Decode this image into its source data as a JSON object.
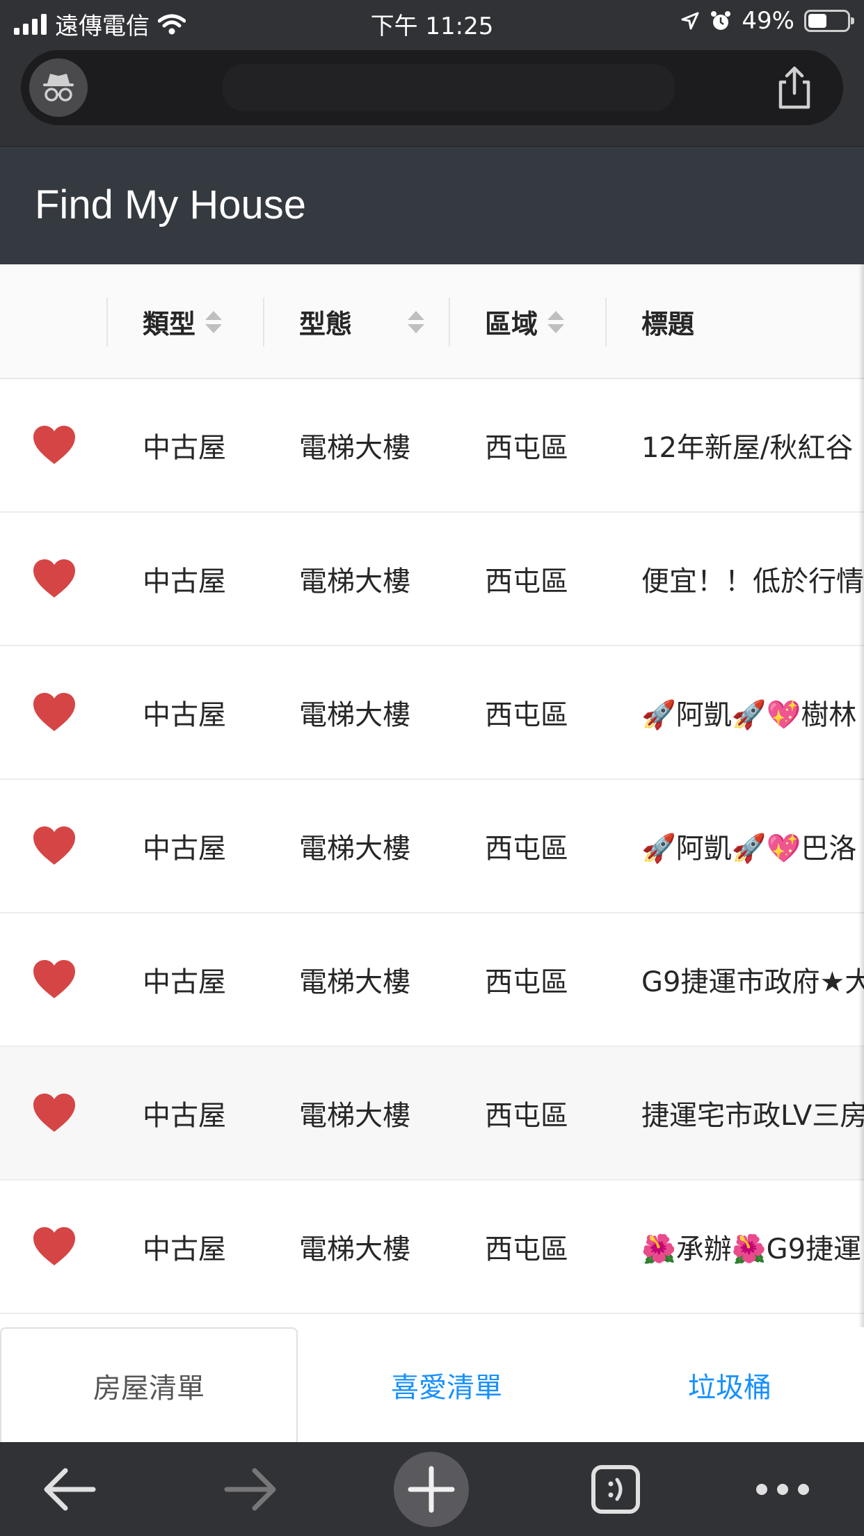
{
  "status_bar": {
    "carrier": "遠傳電信",
    "time": "下午 11:25",
    "battery_percent": "49%",
    "battery_level": 0.49
  },
  "browser": {
    "mode": "incognito",
    "icons": [
      "incognito-icon",
      "share-icon",
      "back-icon",
      "forward-icon",
      "new-tab-icon",
      "tabs-icon",
      "more-icon"
    ]
  },
  "app": {
    "title": "Find My House"
  },
  "table": {
    "columns": [
      {
        "label": "",
        "sortable": false
      },
      {
        "label": "類型",
        "sortable": true
      },
      {
        "label": "型態",
        "sortable": true
      },
      {
        "label": "區域",
        "sortable": true
      },
      {
        "label": "標題",
        "sortable": false
      }
    ],
    "rows": [
      {
        "favorite": true,
        "type": "中古屋",
        "form": "電梯大樓",
        "district": "西屯區",
        "title": "12年新屋/秋紅谷"
      },
      {
        "favorite": true,
        "type": "中古屋",
        "form": "電梯大樓",
        "district": "西屯區",
        "title": "便宜！！低於行情"
      },
      {
        "favorite": true,
        "type": "中古屋",
        "form": "電梯大樓",
        "district": "西屯區",
        "title": "🚀阿凱🚀💖樹林"
      },
      {
        "favorite": true,
        "type": "中古屋",
        "form": "電梯大樓",
        "district": "西屯區",
        "title": "🚀阿凱🚀💖巴洛"
      },
      {
        "favorite": true,
        "type": "中古屋",
        "form": "電梯大樓",
        "district": "西屯區",
        "title": "G9捷運市政府★大"
      },
      {
        "favorite": true,
        "type": "中古屋",
        "form": "電梯大樓",
        "district": "西屯區",
        "title": "捷運宅市政LV三房"
      },
      {
        "favorite": true,
        "type": "中古屋",
        "form": "電梯大樓",
        "district": "西屯區",
        "title": "🌺承辦🌺G9捷運"
      }
    ]
  },
  "tabs": [
    {
      "label": "房屋清單",
      "active": true
    },
    {
      "label": "喜愛清單",
      "active": false
    },
    {
      "label": "垃圾桶",
      "active": false
    }
  ],
  "colors": {
    "chrome": "#313236",
    "header": "#343a40",
    "heart": "#d64545",
    "link": "#1890ff"
  }
}
